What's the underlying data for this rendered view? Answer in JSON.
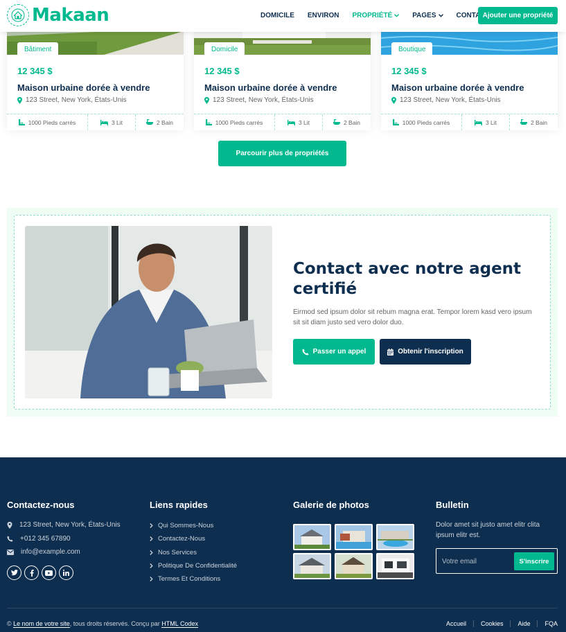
{
  "brand": {
    "name": "Makaan"
  },
  "nav": {
    "items": [
      {
        "label": "DOMICILE",
        "active": false,
        "dropdown": false
      },
      {
        "label": "ENVIRON",
        "active": false,
        "dropdown": false
      },
      {
        "label": "PROPRIÉTÉ",
        "active": true,
        "dropdown": true
      },
      {
        "label": "PAGES",
        "active": false,
        "dropdown": true
      },
      {
        "label": "CONTACT",
        "active": false,
        "dropdown": false
      }
    ],
    "cta": "Ajouter une propriété"
  },
  "properties": [
    {
      "badge": "Bâtiment",
      "price": "12 345 $",
      "title": "Maison urbaine dorée à vendre",
      "address": "123 Street, New York, États-Unis",
      "area": "1000 Pieds carrés",
      "beds": "3 Lit",
      "baths": "2 Bain"
    },
    {
      "badge": "Domicile",
      "price": "12 345 $",
      "title": "Maison urbaine dorée à vendre",
      "address": "123 Street, New York, États-Unis",
      "area": "1000 Pieds carrés",
      "beds": "3 Lit",
      "baths": "2 Bain"
    },
    {
      "badge": "Boutique",
      "price": "12 345 $",
      "title": "Maison urbaine dorée à vendre",
      "address": "123 Street, New York, États-Unis",
      "area": "1000 Pieds carrés",
      "beds": "3 Lit",
      "baths": "2 Bain"
    }
  ],
  "browse_button": "Parcourir plus de propriétés",
  "agent": {
    "title": "Contact avec notre agent certifié",
    "text": "Eirmod sed ipsum dolor sit rebum magna erat. Tempor lorem kasd vero ipsum sit sit diam justo sed vero dolor duo.",
    "call_label": "Passer un appel",
    "appointment_label": "Obtenir l'inscription"
  },
  "footer": {
    "contact": {
      "heading": "Contactez-nous",
      "address": "123 Street, New York, États-Unis",
      "phone": "+012 345 67890",
      "email": "info@example.com",
      "socials": [
        "twitter-icon",
        "facebook-icon",
        "youtube-icon",
        "linkedin-icon"
      ]
    },
    "links": {
      "heading": "Liens rapides",
      "items": [
        "Qui Sommes-Nous",
        "Contactez-Nous",
        "Nos Services",
        "Politique De Confidentialité",
        "Termes Et Conditions"
      ]
    },
    "gallery": {
      "heading": "Galerie de photos"
    },
    "newsletter": {
      "heading": "Bulletin",
      "text": "Dolor amet sit justo amet elitr clita ipsum elitr est.",
      "placeholder": "Votre email",
      "button": "S'inscrire"
    },
    "copyright": {
      "prefix": "©",
      "site_name": "Le nom de votre site",
      "middle": ", tous droits réservés. Conçu par",
      "designer": "HTML Codex"
    },
    "bottom_links": [
      "Accueil",
      "Cookies",
      "Aide",
      "FQA"
    ]
  },
  "colors": {
    "primary": "#00B98E",
    "dark": "#0E2E50",
    "light": "#EFFDF5"
  }
}
